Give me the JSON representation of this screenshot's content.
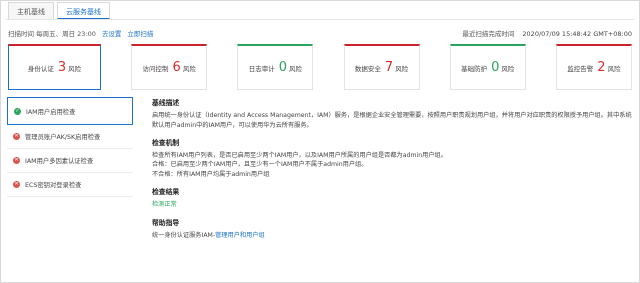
{
  "tabs": [
    {
      "label": "主机基线"
    },
    {
      "label": "云服务基线"
    }
  ],
  "infobar": {
    "schedule": "扫描时间 每周五、周日 23:00",
    "settings_link": "去设置",
    "scan_link": "立即扫描",
    "last_scan_label": "最近扫描完成时间",
    "last_scan_time": "2020/07/09 15:48:42 GMT+08:00"
  },
  "cards": [
    {
      "label": "身份认证",
      "count": "3",
      "unit": "风险",
      "status": "red"
    },
    {
      "label": "访问控制",
      "count": "6",
      "unit": "风险",
      "status": "red"
    },
    {
      "label": "日志审计",
      "count": "0",
      "unit": "风险",
      "status": "green"
    },
    {
      "label": "数据安全",
      "count": "7",
      "unit": "风险",
      "status": "red"
    },
    {
      "label": "基础防护",
      "count": "0",
      "unit": "风险",
      "status": "green"
    },
    {
      "label": "监控告警",
      "count": "2",
      "unit": "风险",
      "status": "red"
    }
  ],
  "checks": [
    {
      "label": "IAM用户启用检查",
      "status": "ok"
    },
    {
      "label": "管理员账户AK/SK启用检查",
      "status": "bad"
    },
    {
      "label": "IAM用户多因素认证检查",
      "status": "bad"
    },
    {
      "label": "ECS密钥对登录检查",
      "status": "bad"
    }
  ],
  "detail": {
    "desc_title": "基线描述",
    "desc_text": "启用统一身份认证（Identity and Access Management，IAM）服务，是根据企业安全管理需要，按照用户职责规划用户组，并将用户对应职责的权限授予用户组。其中系统默认用户admin中的IAM用户，可以使用华为云所有服务。",
    "mech_title": "检查机制",
    "mech_line1": "检查所有IAM用户列表，是否已启用至少两个IAM用户，以及IAM用户所属的用户组是否都为admin用户组。",
    "mech_line2": "合格：已启用至少两个IAM用户，且至少有一个IAM用户不属于admin用户组。",
    "mech_line3": "不合格：所有IAM用户均属于admin用户组",
    "result_title": "检查结果",
    "result_text": "检测正常",
    "help_title": "帮助指导",
    "help_prefix": "统一身份认证服务IAM-",
    "help_link": "管理用户和用户组"
  }
}
